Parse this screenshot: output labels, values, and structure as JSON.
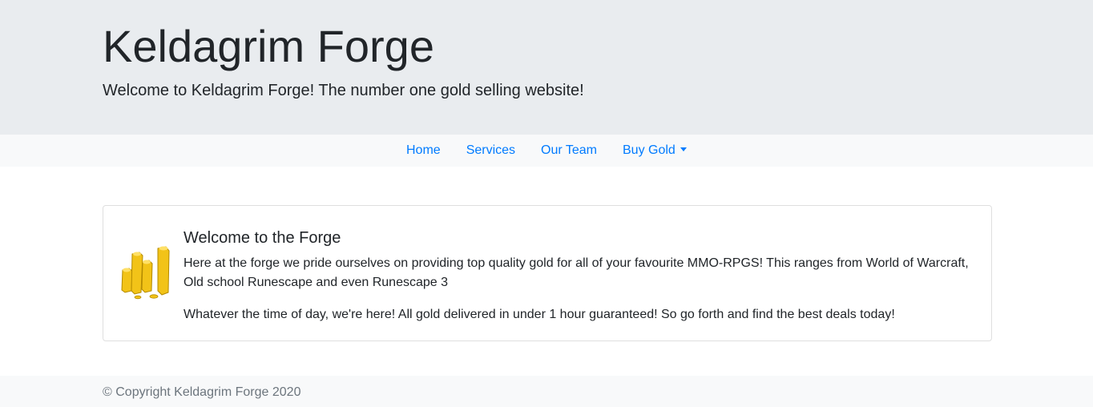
{
  "header": {
    "title": "Keldagrim Forge",
    "tagline": "Welcome to Keldagrim Forge! The number one gold selling website!"
  },
  "nav": {
    "items": [
      {
        "label": "Home"
      },
      {
        "label": "Services"
      },
      {
        "label": "Our Team"
      },
      {
        "label": "Buy Gold",
        "dropdown": true
      }
    ],
    "link_color": "#007bff"
  },
  "card": {
    "image_icon": "gold-coins-stack-icon",
    "title": "Welcome to the Forge",
    "paragraphs": [
      "Here at the forge we pride ourselves on providing top quality gold for all of your favourite MMO-RPGS! This ranges from World of Warcraft, Old school Runescape and even Runescape 3",
      "Whatever the time of day, we're here! All gold delivered in under 1 hour guaranteed! So go forth and find the best deals today!"
    ]
  },
  "footer": {
    "copyright": "© Copyright Keldagrim Forge 2020"
  },
  "colors": {
    "jumbotron_bg": "#e9ecef",
    "navbar_bg": "#f8f9fa",
    "gold": "#f2c318",
    "gold_dark": "#b38a00"
  }
}
